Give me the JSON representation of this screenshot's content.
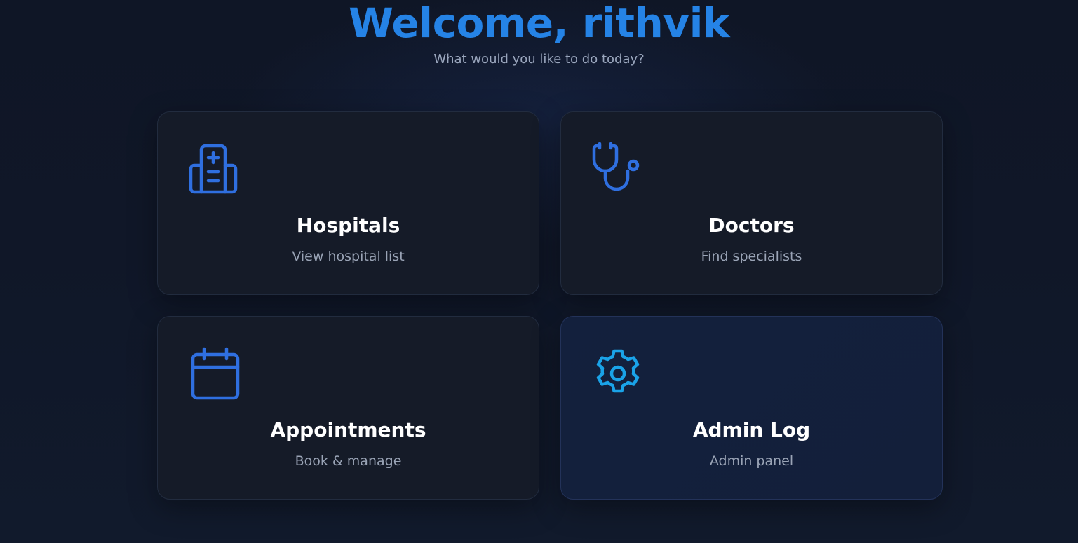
{
  "header": {
    "title": "Welcome, rithvik",
    "subtitle": "What would you like to do today?"
  },
  "cards": [
    {
      "label": "Hospitals",
      "description": "View hospital list",
      "icon": "hospital-icon",
      "icon_color": "#2f6fe0"
    },
    {
      "label": "Doctors",
      "description": "Find specialists",
      "icon": "stethoscope-icon",
      "icon_color": "#2f6fe0"
    },
    {
      "label": "Appointments",
      "description": "Book & manage",
      "icon": "calendar-icon",
      "icon_color": "#2f6fe0"
    },
    {
      "label": "Admin Log",
      "description": "Admin panel",
      "icon": "gear-icon",
      "icon_color": "#1aa3e8"
    }
  ],
  "colors": {
    "accent": "#2583e6",
    "background": "#101728",
    "card": "#151b28",
    "card_active": "#13203d"
  }
}
